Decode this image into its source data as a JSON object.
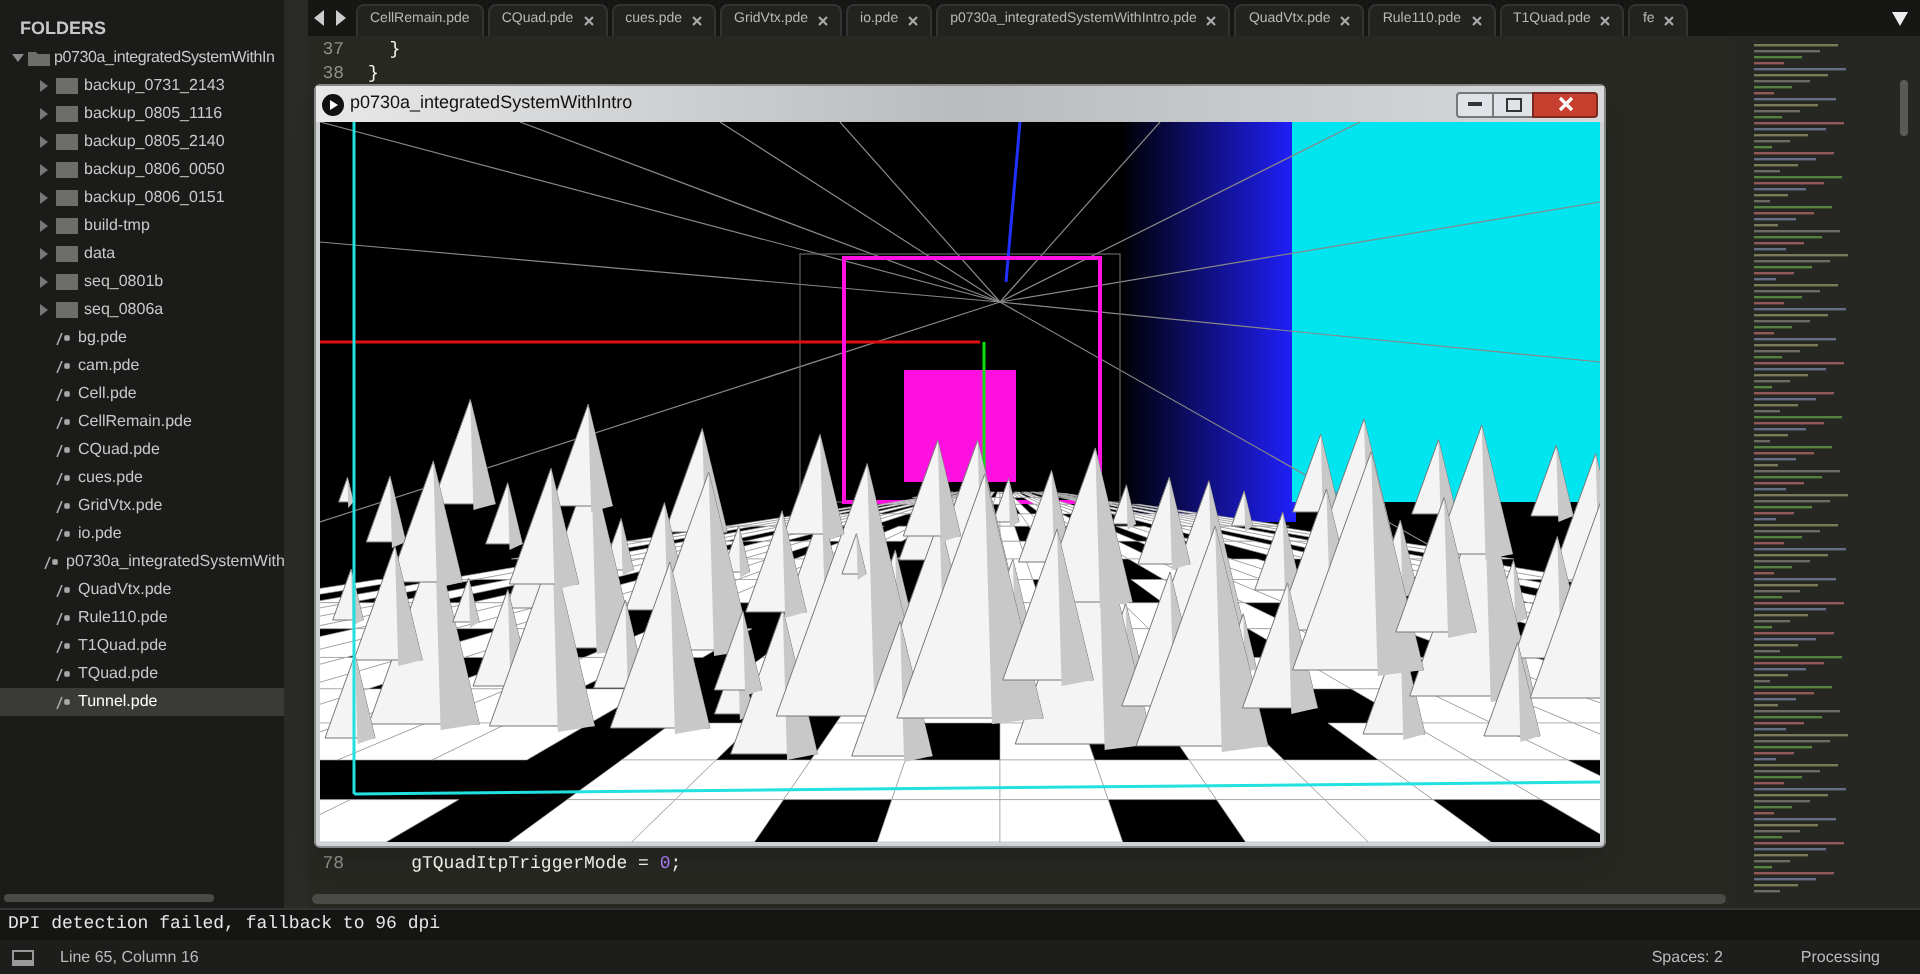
{
  "sidebar": {
    "heading": "FOLDERS",
    "root": {
      "label": "p0730a_integratedSystemWithIn",
      "expanded": true,
      "children": [
        {
          "kind": "folder",
          "label": "backup_0731_2143",
          "expanded": false,
          "selected": false
        },
        {
          "kind": "folder",
          "label": "backup_0805_1116",
          "expanded": false,
          "selected": false
        },
        {
          "kind": "folder",
          "label": "backup_0805_2140",
          "expanded": false,
          "selected": false
        },
        {
          "kind": "folder",
          "label": "backup_0806_0050",
          "expanded": false,
          "selected": false
        },
        {
          "kind": "folder",
          "label": "backup_0806_0151",
          "expanded": false,
          "selected": false
        },
        {
          "kind": "folder",
          "label": "build-tmp",
          "expanded": false,
          "selected": false
        },
        {
          "kind": "folder",
          "label": "data",
          "expanded": false,
          "selected": false
        },
        {
          "kind": "folder",
          "label": "seq_0801b",
          "expanded": false,
          "selected": false
        },
        {
          "kind": "folder",
          "label": "seq_0806a",
          "expanded": false,
          "selected": false
        },
        {
          "kind": "file",
          "label": "bg.pde",
          "selected": false
        },
        {
          "kind": "file",
          "label": "cam.pde",
          "selected": false
        },
        {
          "kind": "file",
          "label": "Cell.pde",
          "selected": false
        },
        {
          "kind": "file",
          "label": "CellRemain.pde",
          "selected": false
        },
        {
          "kind": "file",
          "label": "CQuad.pde",
          "selected": false
        },
        {
          "kind": "file",
          "label": "cues.pde",
          "selected": false
        },
        {
          "kind": "file",
          "label": "GridVtx.pde",
          "selected": false
        },
        {
          "kind": "file",
          "label": "io.pde",
          "selected": false
        },
        {
          "kind": "file",
          "label": "p0730a_integratedSystemWith",
          "selected": false
        },
        {
          "kind": "file",
          "label": "QuadVtx.pde",
          "selected": false
        },
        {
          "kind": "file",
          "label": "Rule110.pde",
          "selected": false
        },
        {
          "kind": "file",
          "label": "T1Quad.pde",
          "selected": false
        },
        {
          "kind": "file",
          "label": "TQuad.pde",
          "selected": false
        },
        {
          "kind": "file",
          "label": "Tunnel.pde",
          "selected": true
        }
      ]
    }
  },
  "tabs": [
    {
      "label": "CellRemain.pde",
      "closable": false
    },
    {
      "label": "CQuad.pde",
      "closable": true
    },
    {
      "label": "cues.pde",
      "closable": true
    },
    {
      "label": "GridVtx.pde",
      "closable": true
    },
    {
      "label": "io.pde",
      "closable": true
    },
    {
      "label": "p0730a_integratedSystemWithIntro.pde",
      "closable": true
    },
    {
      "label": "QuadVtx.pde",
      "closable": true
    },
    {
      "label": "Rule110.pde",
      "closable": true
    },
    {
      "label": "T1Quad.pde",
      "closable": true
    },
    {
      "label": "fe",
      "closable": true
    }
  ],
  "code_top": [
    {
      "number": "37",
      "text": "  }"
    },
    {
      "number": "38",
      "text": "}"
    }
  ],
  "code_bottom": [
    {
      "number": "78",
      "text": "    gTQuadItpTriggerMode = ",
      "literal": "0",
      "end": ";"
    }
  ],
  "sketch_window": {
    "title": "p0730a_integratedSystemWithIntro"
  },
  "console": "DPI detection failed, fallback to 96 dpi",
  "status_bar": {
    "position": "Line 65, Column 16",
    "indentation": "Spaces: 2",
    "syntax": "Processing"
  }
}
